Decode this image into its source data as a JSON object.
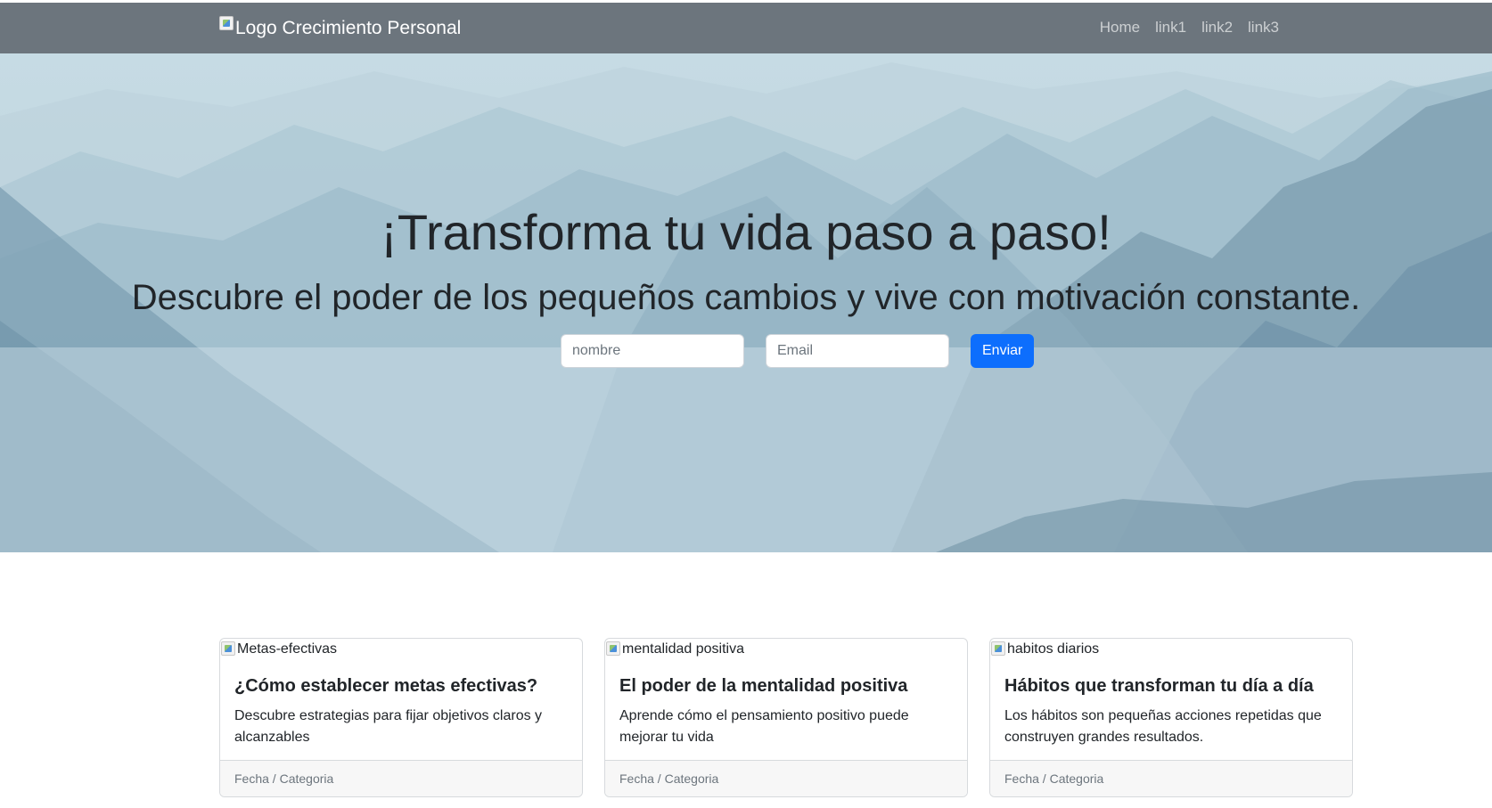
{
  "navbar": {
    "brand_alt": "Logo Crecimiento Personal",
    "links": [
      "Home",
      "link1",
      "link2",
      "link3"
    ]
  },
  "hero": {
    "title": "¡Transforma tu vida paso a paso!",
    "subtitle": "Descubre el poder de los pequeños cambios y vive con motivación constante.",
    "name_placeholder": "nombre",
    "email_placeholder": "Email",
    "submit_label": "Enviar"
  },
  "cards": [
    {
      "img_alt": "Metas-efectivas",
      "title": "¿Cómo establecer metas efectivas?",
      "text": "Descubre estrategias para fijar objetivos claros y alcanzables",
      "footer": "Fecha / Categoria"
    },
    {
      "img_alt": "mentalidad positiva",
      "title": "El poder de la mentalidad positiva",
      "text": "Aprende cómo el pensamiento positivo puede mejorar tu vida",
      "footer": "Fecha / Categoria"
    },
    {
      "img_alt": "habitos diarios",
      "title": "Hábitos que transforman tu día a día",
      "text": "Los hábitos son pequeñas acciones repetidas que construyen grandes resultados.",
      "footer": "Fecha / Categoria"
    }
  ],
  "colors": {
    "navbar_bg": "#6c757d",
    "primary": "#0d6efd",
    "hero_sky": "#c6dbe4"
  }
}
